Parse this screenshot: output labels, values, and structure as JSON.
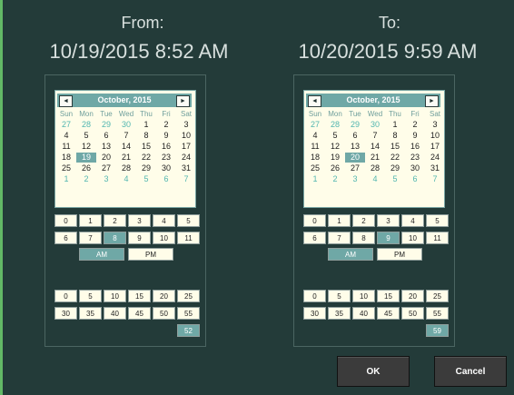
{
  "from": {
    "label": "From:",
    "value": "10/19/2015 8:52 AM",
    "calendar": {
      "month_title": "October, 2015",
      "prev_label": "◄",
      "next_label": "►",
      "weekdays": [
        "Sun",
        "Mon",
        "Tue",
        "Wed",
        "Thu",
        "Fri",
        "Sat"
      ],
      "weeks": [
        [
          "27",
          "28",
          "29",
          "30",
          "1",
          "2",
          "3"
        ],
        [
          "4",
          "5",
          "6",
          "7",
          "8",
          "9",
          "10"
        ],
        [
          "11",
          "12",
          "13",
          "14",
          "15",
          "16",
          "17"
        ],
        [
          "18",
          "19",
          "20",
          "21",
          "22",
          "23",
          "24"
        ],
        [
          "25",
          "26",
          "27",
          "28",
          "29",
          "30",
          "31"
        ],
        [
          "1",
          "2",
          "3",
          "4",
          "5",
          "6",
          "7"
        ]
      ],
      "selected_day": "19"
    },
    "hours": [
      "0",
      "1",
      "2",
      "3",
      "4",
      "5",
      "6",
      "7",
      "8",
      "9",
      "10",
      "11"
    ],
    "selected_hour": "8",
    "am_label": "AM",
    "pm_label": "PM",
    "selected_ampm": "AM",
    "minutes": [
      "0",
      "5",
      "10",
      "15",
      "20",
      "25",
      "30",
      "35",
      "40",
      "45",
      "50",
      "55"
    ],
    "extra_minute": "52"
  },
  "to": {
    "label": "To:",
    "value": "10/20/2015 9:59 AM",
    "calendar": {
      "month_title": "October, 2015",
      "prev_label": "◄",
      "next_label": "►",
      "weekdays": [
        "Sun",
        "Mon",
        "Tue",
        "Wed",
        "Thu",
        "Fri",
        "Sat"
      ],
      "weeks": [
        [
          "27",
          "28",
          "29",
          "30",
          "1",
          "2",
          "3"
        ],
        [
          "4",
          "5",
          "6",
          "7",
          "8",
          "9",
          "10"
        ],
        [
          "11",
          "12",
          "13",
          "14",
          "15",
          "16",
          "17"
        ],
        [
          "18",
          "19",
          "20",
          "21",
          "22",
          "23",
          "24"
        ],
        [
          "25",
          "26",
          "27",
          "28",
          "29",
          "30",
          "31"
        ],
        [
          "1",
          "2",
          "3",
          "4",
          "5",
          "6",
          "7"
        ]
      ],
      "selected_day": "20"
    },
    "hours": [
      "0",
      "1",
      "2",
      "3",
      "4",
      "5",
      "6",
      "7",
      "8",
      "9",
      "10",
      "11"
    ],
    "selected_hour": "9",
    "am_label": "AM",
    "pm_label": "PM",
    "selected_ampm": "AM",
    "minutes": [
      "0",
      "5",
      "10",
      "15",
      "20",
      "25",
      "30",
      "35",
      "40",
      "45",
      "50",
      "55"
    ],
    "extra_minute": "59"
  },
  "buttons": {
    "ok_label": "OK",
    "cancel_label": "Cancel"
  },
  "colors": {
    "background": "#233b39",
    "accent": "#6fa8a6",
    "calendar_bg": "#fffde9",
    "other_month_day": "#52b6b0"
  }
}
